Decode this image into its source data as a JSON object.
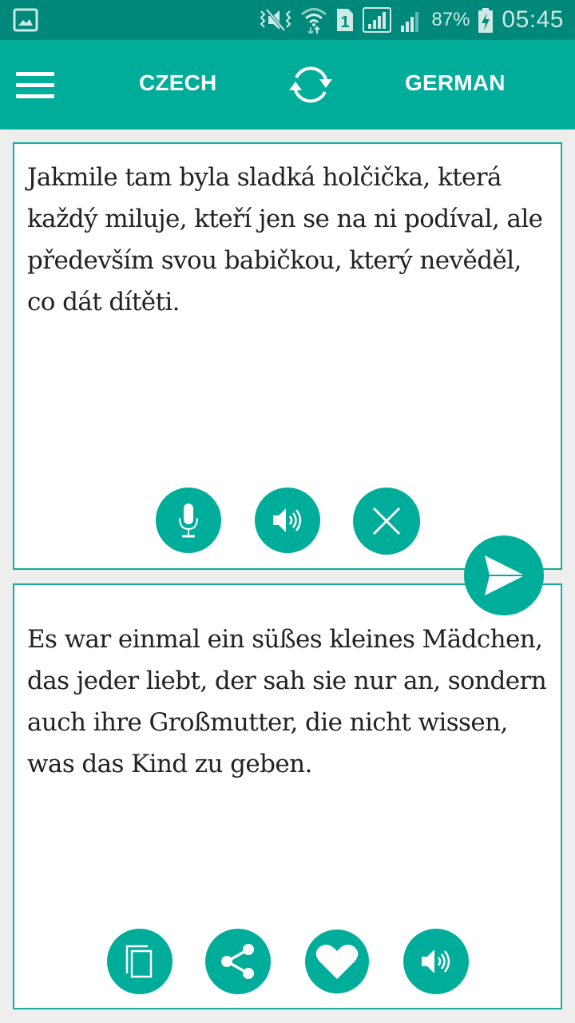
{
  "status_bar": {
    "icons": [
      "gallery-notification-icon",
      "vibrate-mute-icon",
      "wifi-icon",
      "sim-1-icon",
      "signal-sim1-icon",
      "signal-sim2-icon",
      "battery-charging-icon"
    ],
    "battery_percent": "87%",
    "time": "05:45"
  },
  "app_bar": {
    "menu_icon": "hamburger-menu-icon",
    "source_language": "CZECH",
    "target_language": "GERMAN",
    "swap_icon": "swap-languages-icon",
    "accent_color": "#00ad9a",
    "status_bar_color": "#00897b"
  },
  "source_panel": {
    "text": "Jakmile tam byla sladká holčička, která každý miluje, kteří jen se na ni podíval, ale především svou babičkou, který nevěděl, co dát dítěti.",
    "buttons": [
      {
        "name": "microphone",
        "icon": "microphone-icon"
      },
      {
        "name": "speak",
        "icon": "speaker-icon"
      },
      {
        "name": "clear",
        "icon": "close-icon"
      }
    ]
  },
  "translate_button": {
    "icon": "send-icon"
  },
  "target_panel": {
    "text": "Es war einmal ein süßes kleines Mädchen, das jeder liebt, der sah sie nur an, sondern auch ihre Großmutter, die nicht wissen, was das Kind zu geben.",
    "buttons": [
      {
        "name": "copy",
        "icon": "copy-icon"
      },
      {
        "name": "share",
        "icon": "share-icon"
      },
      {
        "name": "favorite",
        "icon": "heart-icon"
      },
      {
        "name": "speak",
        "icon": "speaker-icon"
      }
    ]
  }
}
